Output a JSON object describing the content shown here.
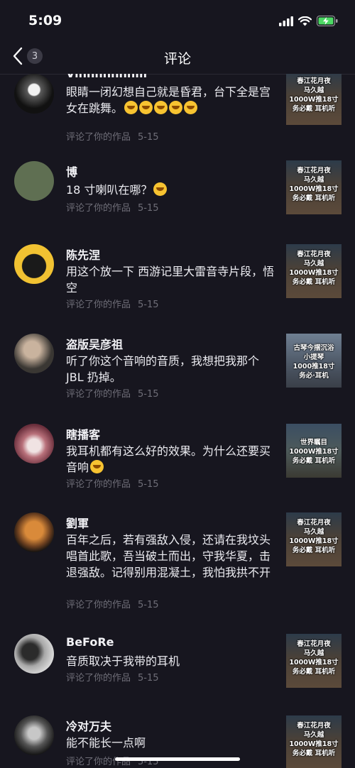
{
  "status_bar": {
    "time": "5:09"
  },
  "nav": {
    "back_count": "3",
    "title": "评论"
  },
  "comments": [
    {
      "name": "Vinnnnnnnm",
      "text": "眼睛一闭幻想自己就是昏君，台下全是宫女在跳舞。",
      "emoji_count": 5,
      "action": "评论了你的作品",
      "date": "5-15",
      "thumb": [
        "春江花月夜",
        "马久越",
        "1000W推18寸",
        "务必戴  耳机听"
      ]
    },
    {
      "name": "博",
      "text": "18 寸喇叭在哪？",
      "emoji_count": 1,
      "action": "评论了你的作品",
      "date": "5-15",
      "thumb": [
        "春江花月夜",
        "马久越",
        "1000W推18寸",
        "务必戴  耳机听"
      ]
    },
    {
      "name": "陈先涅",
      "text": "用这个放一下 西游记里大雷音寺片段，悟空",
      "emoji_count": 0,
      "action": "评论了你的作品",
      "date": "5-15",
      "thumb": [
        "春江花月夜",
        "马久越",
        "1000W推18寸",
        "务必戴  耳机听"
      ]
    },
    {
      "name": "盗版吴彦祖",
      "text": "听了你这个音响的音质，我想把我那个 JBL 扔掉。",
      "emoji_count": 0,
      "action": "评论了你的作品",
      "date": "5-15",
      "thumb": [
        "古琴今摆沉浴",
        "小提琴",
        "1000推18寸",
        "务必·耳机"
      ]
    },
    {
      "name": "瞎播客",
      "text": "我耳机都有这么好的效果。为什么还要买音响",
      "emoji_count": 1,
      "action": "评论了你的作品",
      "date": "5-15",
      "thumb": [
        "世界瞩目",
        "1000W推18寸",
        "务必戴  耳机听"
      ]
    },
    {
      "name": "劉軍",
      "text": "百年之后，若有强敌入侵，还请在我坟头唱首此歌，吾当破土而出，守我华夏，击退强敌。记得别用混凝土，我怕我拱不开",
      "emoji_count": 0,
      "action": "评论了你的作品",
      "date": "5-15",
      "thumb": [
        "春江花月夜",
        "马久越",
        "1000W推18寸",
        "务必戴  耳机听"
      ]
    },
    {
      "name": "BeFoRe",
      "text": "音质取决于我带的耳机",
      "emoji_count": 0,
      "action": "评论了你的作品",
      "date": "5-15",
      "thumb": [
        "春江花月夜",
        "马久越",
        "1000W推18寸",
        "务必戴  耳机听"
      ]
    },
    {
      "name": "冷对万夫",
      "text": "能不能长一点啊",
      "emoji_count": 0,
      "action": "评论了你的作品",
      "date": "5-15",
      "thumb": [
        "春江花月夜",
        "马久越",
        "1000W推18寸",
        "务必戴  耳机听"
      ]
    }
  ]
}
